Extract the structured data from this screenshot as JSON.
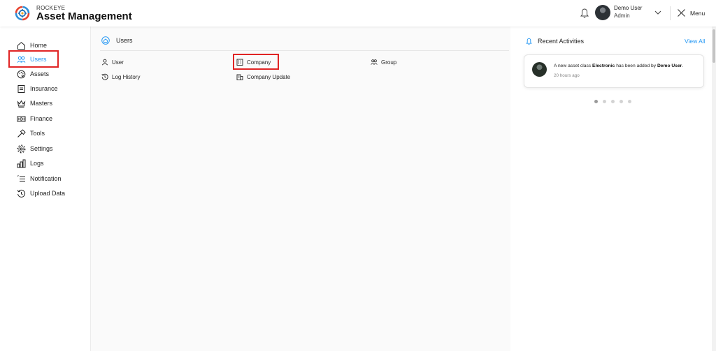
{
  "header": {
    "brand_small": "ROCKEYE",
    "brand_big": "Asset Management",
    "user_name": "Demo User",
    "user_role": "Admin",
    "menu_label": "Menu",
    "icons": [
      "logo-icon",
      "bell-icon",
      "chevron-down-icon",
      "close-icon"
    ]
  },
  "sidebar": {
    "items": [
      {
        "label": "Home",
        "icon": "home-icon"
      },
      {
        "label": "Users",
        "icon": "users-icon",
        "active": true
      },
      {
        "label": "Assets",
        "icon": "palette-icon"
      },
      {
        "label": "Insurance",
        "icon": "document-icon"
      },
      {
        "label": "Masters",
        "icon": "crown-icon"
      },
      {
        "label": "Finance",
        "icon": "money-icon"
      },
      {
        "label": "Tools",
        "icon": "hammer-icon"
      },
      {
        "label": "Settings",
        "icon": "gear-icon"
      },
      {
        "label": "Logs",
        "icon": "bar-chart-icon"
      },
      {
        "label": "Notification",
        "icon": "list-icon"
      },
      {
        "label": "Upload Data",
        "icon": "history-icon"
      }
    ],
    "active_color": "#2196f3"
  },
  "main": {
    "section_title": "Users",
    "links": [
      {
        "label": "User",
        "icon": "user-icon"
      },
      {
        "label": "Company",
        "icon": "building-icon"
      },
      {
        "label": "Group",
        "icon": "group-icon"
      },
      {
        "label": "Log History",
        "icon": "history-icon"
      },
      {
        "label": "Company Update",
        "icon": "building-update-icon"
      }
    ]
  },
  "activities": {
    "title": "Recent Activities",
    "view_all": "View All",
    "item": {
      "prefix": "A new asset class ",
      "asset": "Electronic",
      "middle": " has been added by ",
      "user": "Demo User",
      "suffix": ".",
      "time": "20 hours ago"
    },
    "dots": 5,
    "active_dot": 0
  },
  "colors": {
    "accent": "#2196f3",
    "highlight": "#e02424"
  }
}
